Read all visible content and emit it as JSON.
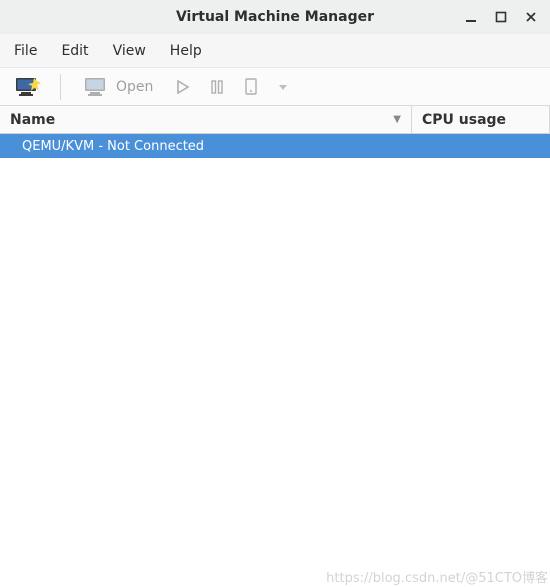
{
  "window": {
    "title": "Virtual Machine Manager"
  },
  "menubar": {
    "file": "File",
    "edit": "Edit",
    "view": "View",
    "help": "Help"
  },
  "toolbar": {
    "open_label": "Open"
  },
  "columns": {
    "name": "Name",
    "cpu": "CPU usage"
  },
  "vm_list": {
    "items": [
      {
        "label": "QEMU/KVM - Not Connected"
      }
    ]
  },
  "watermark": "https://blog.csdn.net/@51CTO博客"
}
